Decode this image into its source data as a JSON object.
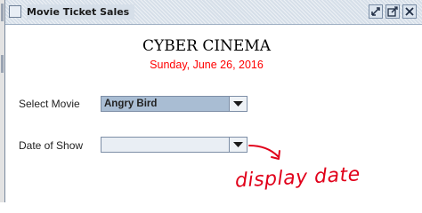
{
  "window": {
    "title": "Movie Ticket Sales",
    "buttons": {
      "restore": "restore-icon",
      "maximize": "maximize-icon",
      "close": "close-icon"
    }
  },
  "header": {
    "cinema_name": "CYBER CINEMA",
    "date": "Sunday, June 26, 2016",
    "date_color": "#ff0000"
  },
  "form": {
    "movie_label": "Select Movie",
    "movie_value": "Angry Bird",
    "show_date_label": "Date of Show",
    "show_date_value": ""
  },
  "annotation": {
    "text": "display date",
    "color": "#e1001a"
  }
}
